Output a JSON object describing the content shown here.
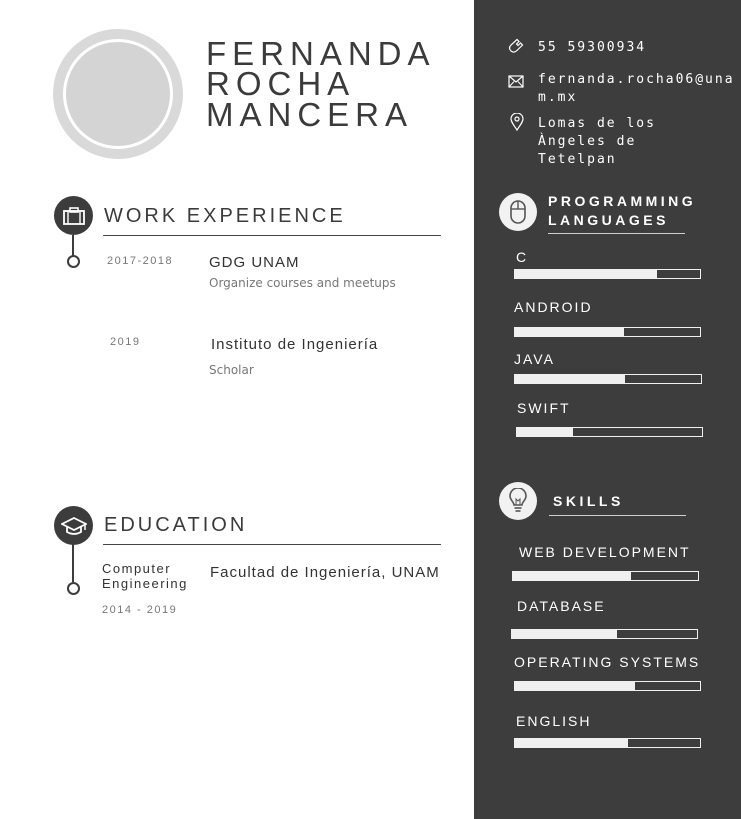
{
  "name": {
    "line1": "FERNANDA",
    "line2": "ROCHA",
    "line3": "MANCERA"
  },
  "contact": {
    "phone": "55 59300934",
    "email_line1": "fernanda.rocha06@una",
    "email_line2": "m.mx",
    "address_line1": "Lomas de los",
    "address_line2": "Àngeles de",
    "address_line3": "Tetelpan"
  },
  "work": {
    "title": "WORK EXPERIENCE",
    "items": [
      {
        "date": "2017-2018",
        "org": "GDG UNAM",
        "desc": "Organize courses and meetups"
      },
      {
        "date": "2019",
        "org": "Instituto de Ingeniería",
        "desc": "Scholar"
      }
    ]
  },
  "education": {
    "title": "EDUCATION",
    "degree_line1": "Computer",
    "degree_line2": "Engineering",
    "years": "2014 - 2019",
    "school": "Facultad de Ingeniería, UNAM"
  },
  "programming": {
    "title_line1": "PROGRAMMING",
    "title_line2": "LANGUAGES",
    "items": [
      {
        "label": "C",
        "level": 0.77
      },
      {
        "label": "ANDROID",
        "level": 0.59
      },
      {
        "label": "JAVA",
        "level": 0.59
      },
      {
        "label": "SWIFT",
        "level": 0.3
      }
    ]
  },
  "skills": {
    "title": "SKILLS",
    "items": [
      {
        "label": "WEB DEVELOPMENT",
        "level": 0.64
      },
      {
        "label": "DATABASE",
        "level": 0.57
      },
      {
        "label": "OPERATING SYSTEMS",
        "level": 0.65
      },
      {
        "label": "ENGLISH",
        "level": 0.61
      }
    ]
  },
  "colors": {
    "panel": "#3d3d3d",
    "accent": "#3c3c3c",
    "bar": "#f0f0f0",
    "avatar": "#d9d9d9"
  },
  "icons": [
    "phone-icon",
    "mail-icon",
    "location-icon",
    "briefcase-icon",
    "graduation-cap-icon",
    "mouse-icon",
    "lightbulb-icon"
  ]
}
